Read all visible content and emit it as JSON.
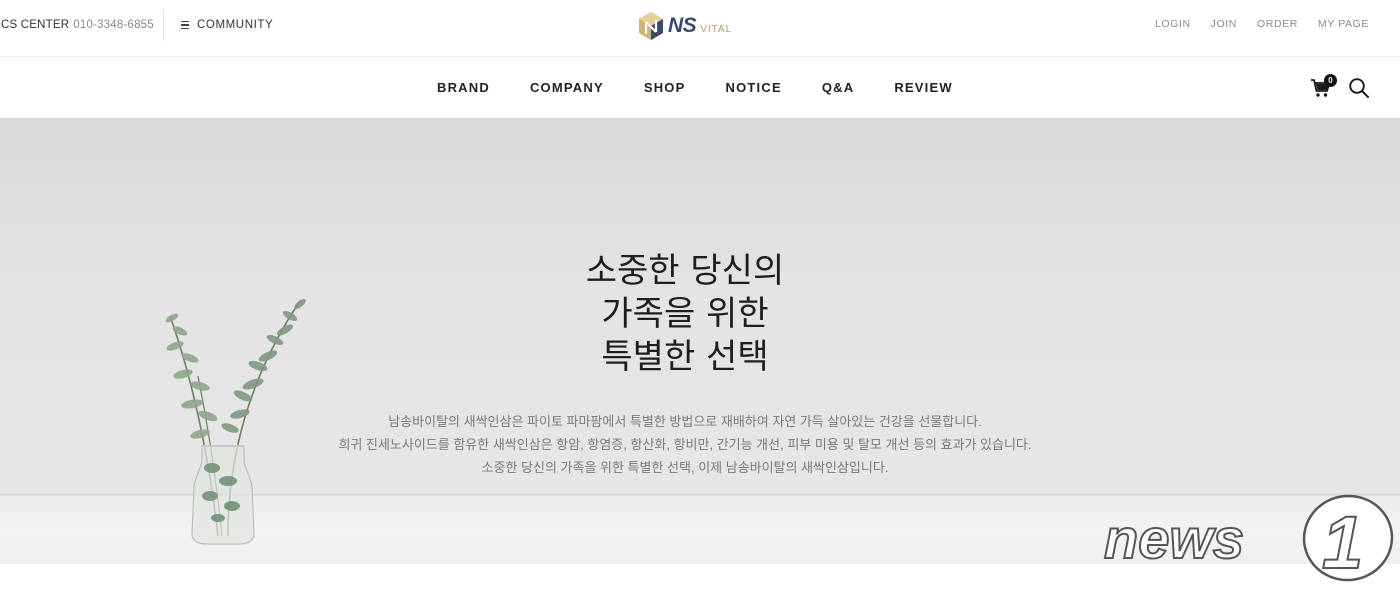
{
  "topbar": {
    "cs_label": "CS CENTER",
    "cs_phone": "010-3348-6855",
    "community_label": "COMMUNITY",
    "logo_text": "NS",
    "logo_subtext": "VITAL",
    "user_links": [
      "LOGIN",
      "JOIN",
      "ORDER",
      "MY PAGE"
    ]
  },
  "nav": {
    "items": [
      "BRAND",
      "COMPANY",
      "SHOP",
      "NOTICE",
      "Q&A",
      "REVIEW"
    ],
    "cart_count": "0"
  },
  "hero": {
    "headline": [
      "소중한 당신의",
      "가족을 위한",
      "특별한 선택"
    ],
    "description": [
      "남송바이탈의 새싹인삼은 파이토 파마팜에서 특별한 방법으로 재배하여 자연 가득 살아있는 건강을 선물합니다.",
      "희귀 진세노사이드를 함유한 새싹인삼은 항암, 항염증, 항산화, 항비만, 간기능 개선, 피부 미용 및 탈모 개선 등의 효과가 있습니다.",
      "소중한 당신의 가족을 위한 특별한 선택, 이제 남송바이탈의 새싹인삼입니다."
    ]
  },
  "watermark": {
    "text": "news",
    "digit": "1"
  },
  "colors": {
    "logo_navy": "#3c4a69",
    "logo_gold": "#b29a63",
    "text_dark": "#222222",
    "text_muted": "#8a8a8a",
    "hero_bg": "#e4e4e4"
  },
  "icons": [
    "hamburger-icon",
    "cart-icon",
    "search-icon",
    "logo-mark-icon",
    "vase-plant-image"
  ]
}
